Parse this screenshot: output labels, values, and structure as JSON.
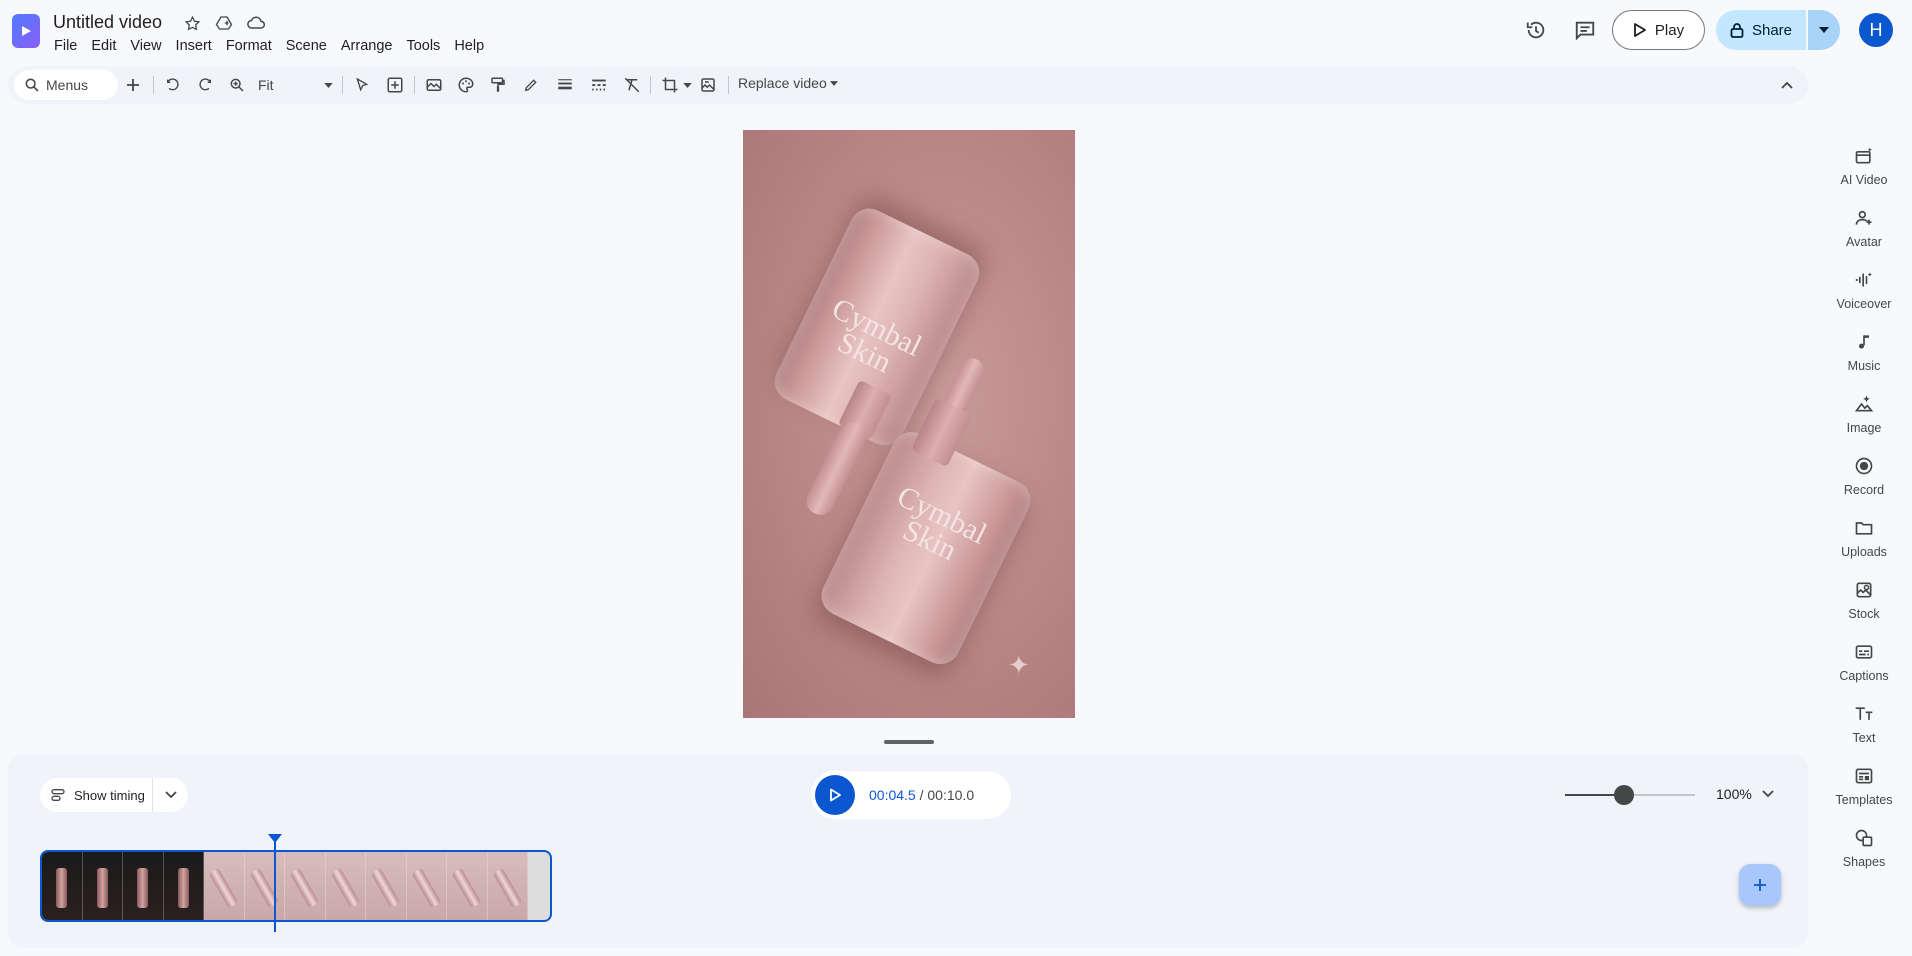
{
  "header": {
    "title": "Untitled video",
    "menus": [
      "File",
      "Edit",
      "View",
      "Insert",
      "Format",
      "Scene",
      "Arrange",
      "Tools",
      "Help"
    ],
    "play_label": "Play",
    "share_label": "Share",
    "avatar_letter": "H"
  },
  "toolbar": {
    "search_label": "Menus",
    "zoom_value": "Fit",
    "replace_label": "Replace video"
  },
  "canvas": {
    "brand_text_top": "Cymbal Skin",
    "brand_text_bottom": "Cymbal Skin"
  },
  "timeline": {
    "show_timing_label": "Show timing",
    "current_time": "00:04.5",
    "separator": " / ",
    "total_time": "00:10.0",
    "zoom_percent": "100%",
    "zoom_level": 0.45
  },
  "sidebar": {
    "items": [
      {
        "label": "AI Video",
        "icon": "ai-video-icon"
      },
      {
        "label": "Avatar",
        "icon": "avatar-add-icon"
      },
      {
        "label": "Voiceover",
        "icon": "voiceover-icon"
      },
      {
        "label": "Music",
        "icon": "music-note-icon"
      },
      {
        "label": "Image",
        "icon": "image-spark-icon"
      },
      {
        "label": "Record",
        "icon": "record-icon"
      },
      {
        "label": "Uploads",
        "icon": "folder-icon"
      },
      {
        "label": "Stock",
        "icon": "stock-icon"
      },
      {
        "label": "Captions",
        "icon": "captions-icon"
      },
      {
        "label": "Text",
        "icon": "text-icon"
      },
      {
        "label": "Templates",
        "icon": "templates-icon"
      },
      {
        "label": "Shapes",
        "icon": "shapes-icon"
      }
    ]
  },
  "colors": {
    "accent": "#0b57d0",
    "share_bg": "#c2e7ff",
    "canvas_bg": "#b98686"
  }
}
